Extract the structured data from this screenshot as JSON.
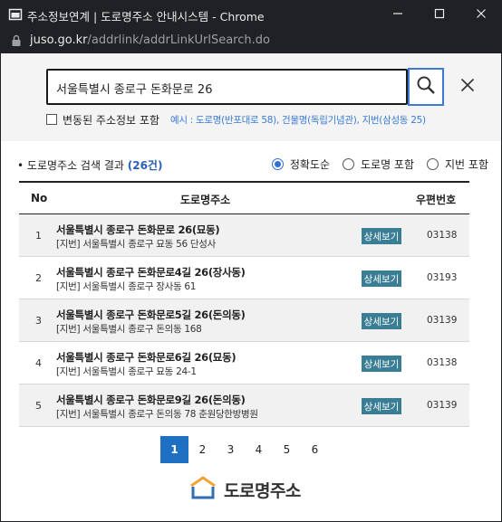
{
  "window": {
    "title": "주소정보연계 | 도로명주소 안내시스템 - Chrome"
  },
  "address_bar": {
    "host": "juso.go.kr",
    "path": "/addrlink/addrLinkUrlSearch.do"
  },
  "search": {
    "value": "서울특별시 종로구 돈화문로 26",
    "include_changed_label": "변동된 주소정보 포함",
    "example_text": "예시 : 도로명(반포대로 58), 건물명(독립기념관), 지번(삼성동 25)"
  },
  "results": {
    "title": "도로명주소 검색 결과",
    "count": "(26건)",
    "radios": [
      {
        "label": "정확도순",
        "checked": true
      },
      {
        "label": "도로명 포함",
        "checked": false
      },
      {
        "label": "지번 포함",
        "checked": false
      }
    ],
    "headers": {
      "no": "No",
      "road": "도로명주소",
      "zip": "우편번호"
    },
    "detail_label": "상세보기",
    "rows": [
      {
        "no": "1",
        "road": "서울특별시 종로구 돈화문로 26(묘동)",
        "jibun": "[지번] 서울특별시 종로구 묘동 56 단성사",
        "zip": "03138"
      },
      {
        "no": "2",
        "road": "서울특별시 종로구 돈화문로4길 26(장사동)",
        "jibun": "[지번] 서울특별시 종로구 장사동 61",
        "zip": "03193"
      },
      {
        "no": "3",
        "road": "서울특별시 종로구 돈화문로5길 26(돈의동)",
        "jibun": "[지번] 서울특별시 종로구 돈의동 168",
        "zip": "03139"
      },
      {
        "no": "4",
        "road": "서울특별시 종로구 돈화문로6길 26(묘동)",
        "jibun": "[지번] 서울특별시 종로구 묘동 24-1",
        "zip": "03138"
      },
      {
        "no": "5",
        "road": "서울특별시 종로구 돈화문로9길 26(돈의동)",
        "jibun": "[지번] 서울특별시 종로구 돈의동 78 춘원당한방병원",
        "zip": "03139"
      }
    ]
  },
  "pagination": {
    "pages": [
      "1",
      "2",
      "3",
      "4",
      "5",
      "6"
    ],
    "current": "1"
  },
  "logo": {
    "text": "도로명주소"
  },
  "colors": {
    "accent": "#1f6fc2",
    "detail_button": "#3a7e96",
    "count": "#2b5fb4",
    "example": "#3a7bd5"
  }
}
